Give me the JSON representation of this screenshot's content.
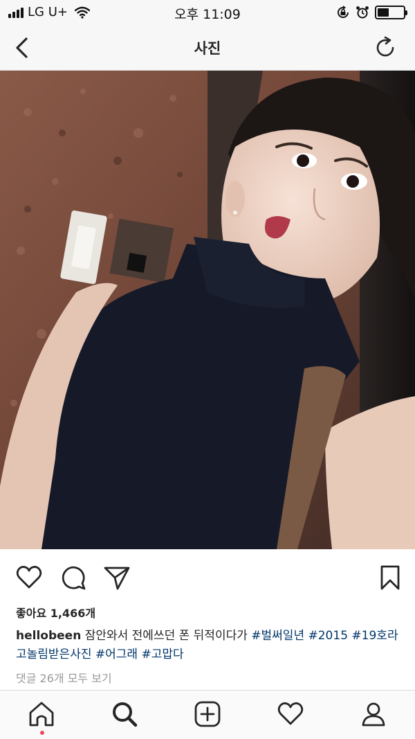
{
  "status_bar": {
    "carrier": "LG U+",
    "time": "오후 11:09",
    "battery_level": 0.45
  },
  "nav": {
    "title": "사진",
    "back_icon": "chevron-left-icon",
    "refresh_icon": "refresh-icon"
  },
  "post": {
    "likes_text": "좋아요 1,466개",
    "username": "hellobeen",
    "caption_text": " 잠안와서 전에쓰던 폰 뒤적이다가 ",
    "hashtags": [
      "#벌써일년",
      "#2015",
      "#19호라고놀림받은사진",
      "#어그래",
      "#고맙다"
    ],
    "comments_link": "댓글 26개 모두 보기",
    "action_icons": [
      "heart-icon",
      "comment-icon",
      "share-icon",
      "bookmark-icon"
    ]
  },
  "tab_bar": {
    "icons": [
      "home-icon",
      "search-icon",
      "add-post-icon",
      "activity-heart-icon",
      "profile-icon"
    ]
  },
  "colors": {
    "hashtag": "#003569",
    "muted": "#999999",
    "text": "#262626",
    "notification_dot": "#ed4956"
  }
}
